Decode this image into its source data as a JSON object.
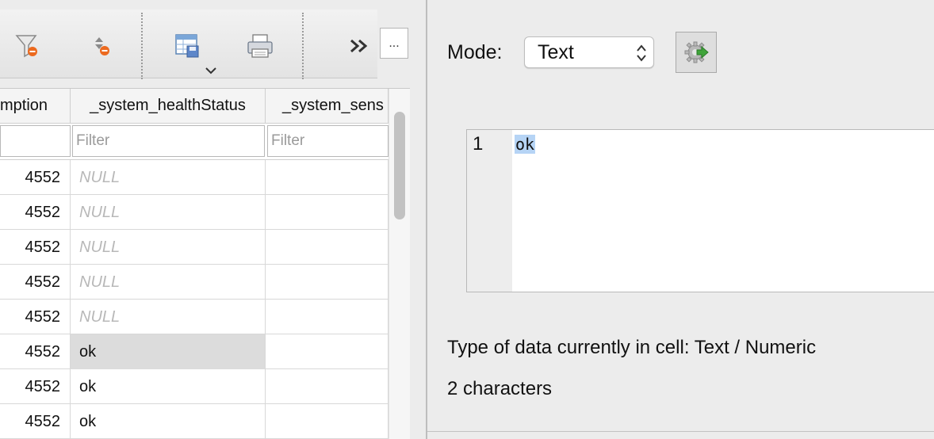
{
  "toolbar": {
    "buttons": [
      {
        "icon": "clear-filters-icon"
      },
      {
        "icon": "clear-sort-icon"
      },
      {
        "icon": "save-table-icon"
      },
      {
        "icon": "print-icon"
      },
      {
        "icon": "chevrons-right-icon"
      }
    ],
    "more_label": "..."
  },
  "table": {
    "columns": [
      "mption",
      "_system_healthStatus",
      "_system_sens"
    ],
    "filter_placeholder": "Filter",
    "rows": [
      {
        "c1": "4552",
        "c2": "NULL",
        "c2_null": true
      },
      {
        "c1": "4552",
        "c2": "NULL",
        "c2_null": true
      },
      {
        "c1": "4552",
        "c2": "NULL",
        "c2_null": true
      },
      {
        "c1": "4552",
        "c2": "NULL",
        "c2_null": true
      },
      {
        "c1": "4552",
        "c2": "NULL",
        "c2_null": true
      },
      {
        "c1": "4552",
        "c2": "ok",
        "c2_null": false,
        "selected": true
      },
      {
        "c1": "4552",
        "c2": "ok",
        "c2_null": false
      },
      {
        "c1": "4552",
        "c2": "ok",
        "c2_null": false
      }
    ]
  },
  "edit_cell": {
    "mode_label": "Mode:",
    "mode_value": "Text",
    "line_number": "1",
    "content": "ok",
    "type_info": "Type of data currently in cell: Text / Numeric",
    "char_count": "2 characters"
  },
  "colors": {
    "selection_highlight": "#b6d4f5",
    "null_text": "#b8b8b8",
    "selected_cell": "#dcdcdc"
  }
}
